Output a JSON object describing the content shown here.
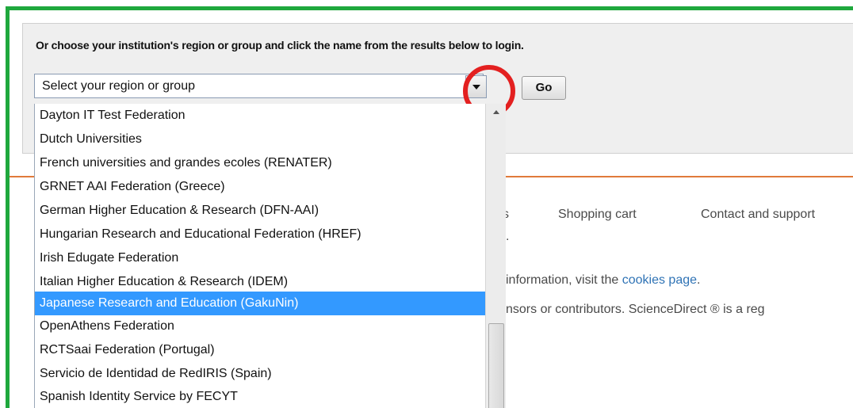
{
  "form": {
    "instruction": "Or choose your institution's region or group and click the name from the results below to login.",
    "select_value": "Select your region or group",
    "go_label": "Go"
  },
  "dropdown": {
    "options": [
      "Dayton IT Test Federation",
      "Dutch Universities",
      "French universities and grandes ecoles (RENATER)",
      "GRNET AAI Federation (Greece)",
      "German Higher Education & Research (DFN-AAI)",
      "Hungarian Research and Educational Federation (HREF)",
      "Irish Edugate Federation",
      "Italian Higher Education & Research (IDEM)",
      "Japanese Research and Education (GakuNin)",
      "OpenAthens Federation",
      "RCTSaai Federation (Portugal)",
      "Servicio de Identidad de RedIRIS (Spain)",
      "Spanish Identity Service by FECYT"
    ],
    "selected": "Japanese Research and Education (GakuNin)"
  },
  "footer": {
    "nav_partial": "s",
    "shopping_cart": "Shopping cart",
    "contact_support": "Contact and support",
    "dot": ".",
    "cookies_prefix": "information, visit the ",
    "cookies_link": "cookies page",
    "cookies_suffix": ".",
    "copyright_partial": "nsors or contributors. ScienceDirect ® is a reg"
  },
  "colors": {
    "frame": "#1fa83d",
    "highlight_ring": "#e32020",
    "selection": "#3399ff",
    "divider": "#e07a3a",
    "link": "#2f73b5"
  }
}
